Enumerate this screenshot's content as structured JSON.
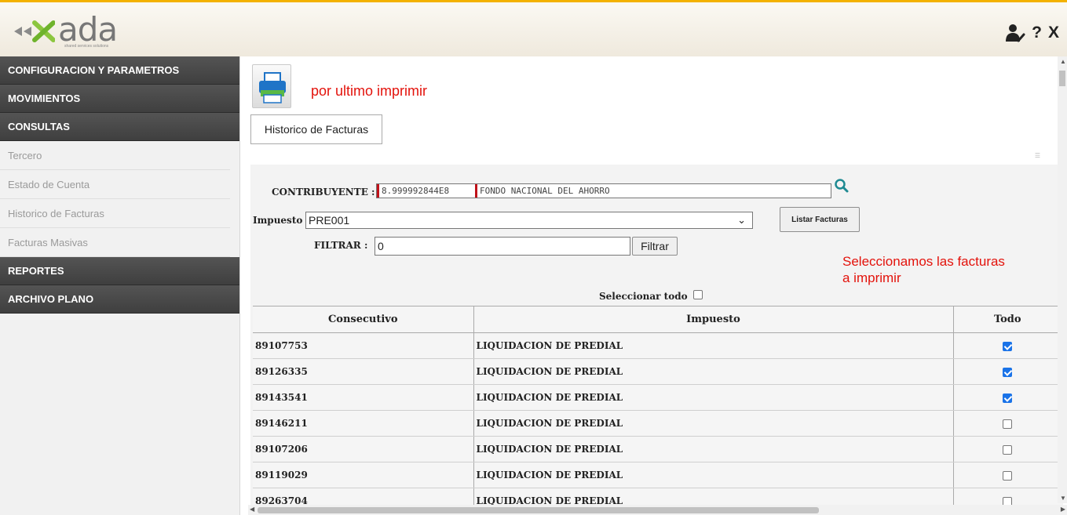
{
  "header": {
    "logo_text": "ada",
    "logo_tagline": "shared services solutions",
    "user_icon": "user-settings-icon",
    "help_label": "?",
    "close_label": "X",
    "accent_color": "#f3b200"
  },
  "sidebar": {
    "sections": [
      {
        "label": "CONFIGURACION Y PARAMETROS"
      },
      {
        "label": "MOVIMIENTOS"
      },
      {
        "label": "CONSULTAS"
      }
    ],
    "items": [
      {
        "label": "Tercero"
      },
      {
        "label": "Estado de Cuenta"
      },
      {
        "label": "Historico de Facturas"
      },
      {
        "label": "Facturas Masivas"
      }
    ],
    "bottom_sections": [
      {
        "label": "REPORTES"
      },
      {
        "label": "ARCHIVO PLANO"
      }
    ]
  },
  "main": {
    "print_icon": "printer-icon",
    "print_note": "por ultimo imprimir",
    "tab_label": "Historico de Facturas",
    "contribuyente_label": "CONTRIBUYENTE :",
    "contribuyente_id": "8.999992844E8",
    "contribuyente_name": "FONDO NACIONAL DEL AHORRO",
    "search_icon": "search-icon",
    "impuesto_label": "Impuesto",
    "impuesto_value": "PRE001",
    "listar_button": "Listar Facturas",
    "filtrar_label": "FILTRAR :",
    "filtrar_value": "0",
    "filtrar_button": "Filtrar",
    "annotation_line1": "Seleccionamos las facturas",
    "annotation_line2": "a imprimir",
    "seleccionar_todo": "Seleccionar todo"
  },
  "table": {
    "headers": [
      "Consecutivo",
      "Impuesto",
      "Todo"
    ],
    "rows": [
      {
        "consecutivo": "89107753",
        "impuesto": "LIQUIDACION DE PREDIAL",
        "checked": true
      },
      {
        "consecutivo": "89126335",
        "impuesto": "LIQUIDACION DE PREDIAL",
        "checked": true
      },
      {
        "consecutivo": "89143541",
        "impuesto": "LIQUIDACION DE PREDIAL",
        "checked": true
      },
      {
        "consecutivo": "89146211",
        "impuesto": "LIQUIDACION DE PREDIAL",
        "checked": false
      },
      {
        "consecutivo": "89107206",
        "impuesto": "LIQUIDACION DE PREDIAL",
        "checked": false
      },
      {
        "consecutivo": "89119029",
        "impuesto": "LIQUIDACION DE PREDIAL",
        "checked": false
      },
      {
        "consecutivo": "89263704",
        "impuesto": "LIQUIDACION DE PREDIAL",
        "checked": false
      }
    ]
  }
}
